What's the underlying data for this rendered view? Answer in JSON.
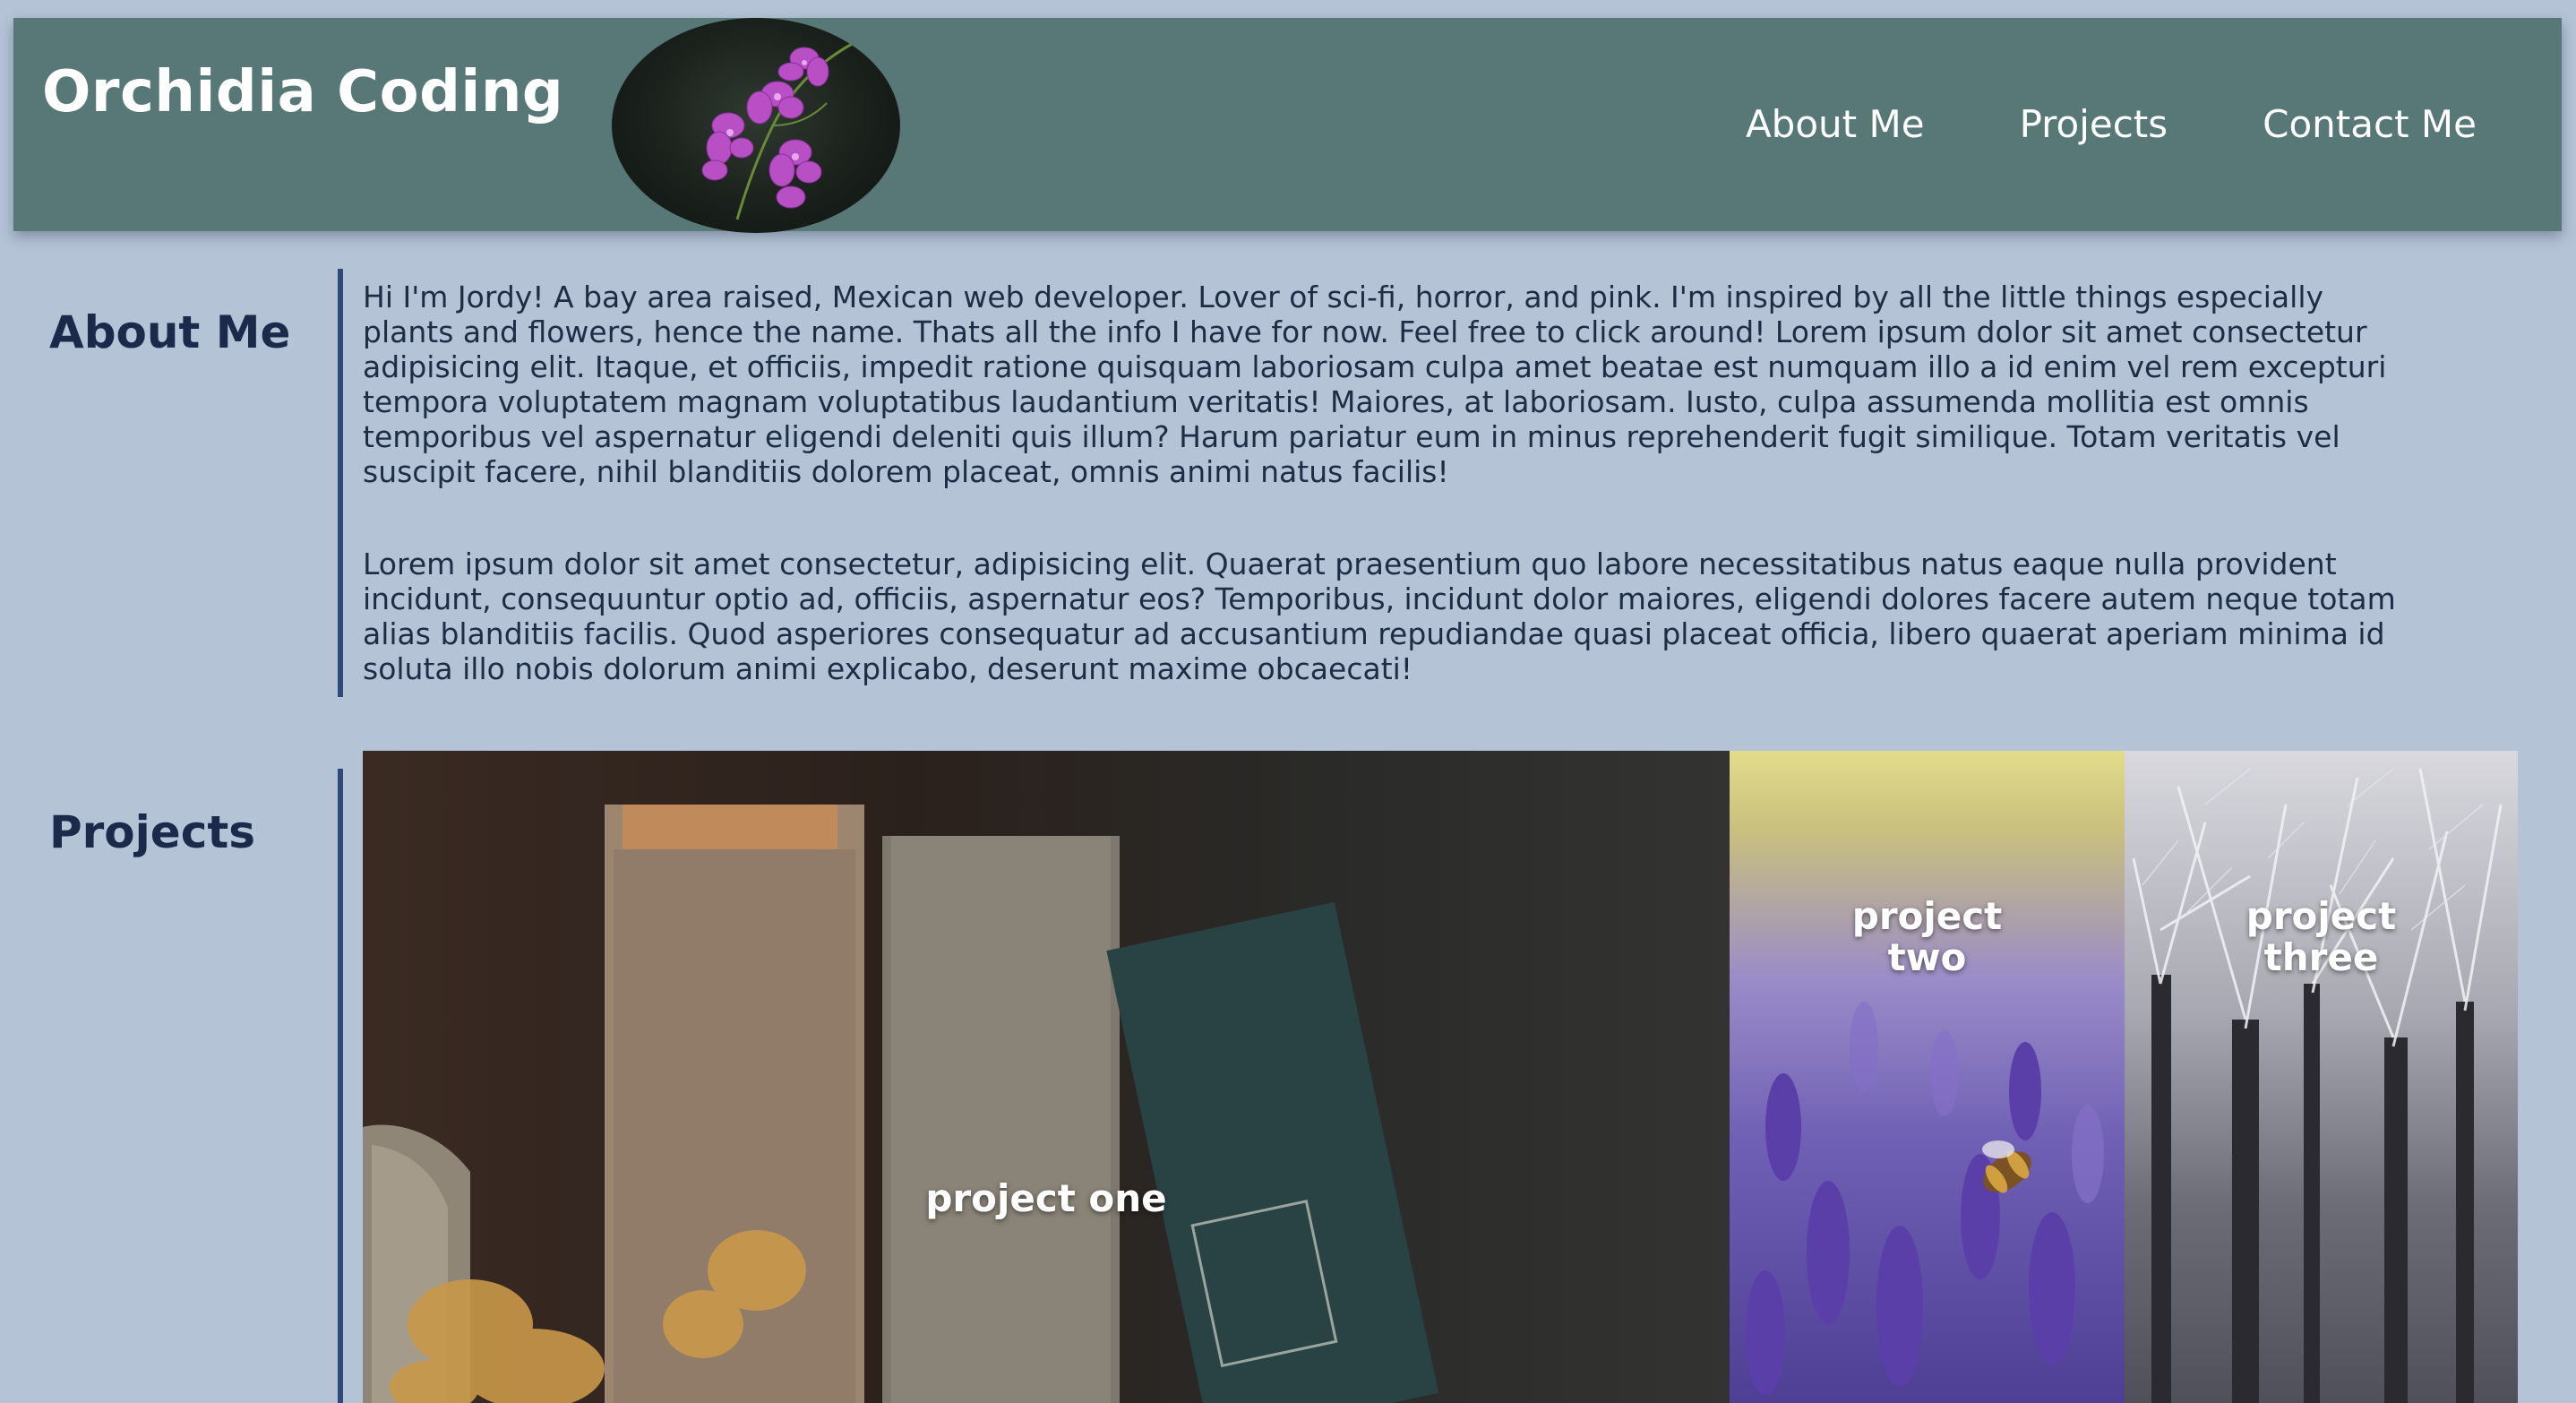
{
  "header": {
    "brand": "Orchidia Coding",
    "nav": [
      "About Me",
      "Projects",
      "Contact Me"
    ]
  },
  "about": {
    "title": "About Me",
    "paragraphs": [
      "Hi I'm Jordy! A bay area raised, Mexican web developer. Lover of sci-fi, horror, and pink. I'm inspired by all the little things especially plants and flowers, hence the name. Thats all the info I have for now. Feel free to click around! Lorem ipsum dolor sit amet consectetur adipisicing elit. Itaque, et officiis, impedit ratione quisquam laboriosam culpa amet beatae est numquam illo a id enim vel rem excepturi tempora voluptatem magnam voluptatibus laudantium veritatis! Maiores, at laboriosam. Iusto, culpa assumenda mollitia est omnis temporibus vel aspernatur eligendi deleniti quis illum? Harum pariatur eum in minus reprehenderit fugit similique. Totam veritatis vel suscipit facere, nihil blanditiis dolorem placeat, omnis animi natus facilis!",
      "Lorem ipsum dolor sit amet consectetur, adipisicing elit. Quaerat praesentium quo labore necessitatibus natus eaque nulla provident incidunt, consequuntur optio ad, officiis, aspernatur eos? Temporibus, incidunt dolor maiores, eligendi dolores facere autem neque totam alias blanditiis facilis. Quod asperiores consequatur ad accusantium repudiandae quasi placeat officia, libero quaerat aperiam minima id soluta illo nobis dolorum animi explicabo, deserunt maxime obcaecati!"
    ]
  },
  "projects": {
    "title": "Projects",
    "items": [
      {
        "label": "project one"
      },
      {
        "label": "project two"
      },
      {
        "label": "project three"
      }
    ]
  },
  "colors": {
    "background": "#b4c4d6",
    "header": "#587878",
    "accent_rule": "#2f4a7a",
    "heading": "#1b2a4a"
  },
  "icons": {
    "logo": "orchid-logo-icon"
  }
}
